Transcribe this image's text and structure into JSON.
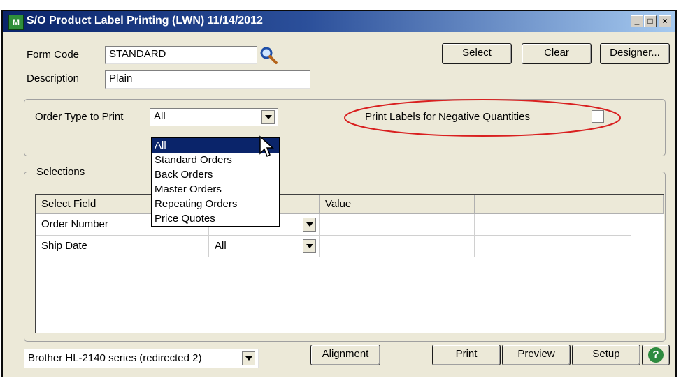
{
  "window": {
    "title": "S/O Product Label Printing (LWN) 11/14/2012",
    "app_icon_label": "M",
    "minimize_label": "_",
    "maximize_label": "□",
    "close_label": "×"
  },
  "form": {
    "form_code_label": "Form Code",
    "form_code_value": "STANDARD",
    "description_label": "Description",
    "description_value": "Plain"
  },
  "top_buttons": {
    "select": "Select",
    "clear": "Clear",
    "designer": "Designer..."
  },
  "order_type": {
    "label": "Order Type to Print",
    "selected": "All",
    "options": [
      "All",
      "Standard Orders",
      "Back Orders",
      "Master Orders",
      "Repeating Orders",
      "Price Quotes"
    ]
  },
  "negative_qty": {
    "label": "Print Labels for Negative Quantities",
    "checked": false,
    "highlight_color": "#d92020"
  },
  "selections": {
    "group_label": "Selections",
    "headers": [
      "Select Field",
      "",
      "Value",
      ""
    ],
    "rows": [
      {
        "field": "Order Number",
        "select": "All",
        "value": ""
      },
      {
        "field": "Ship Date",
        "select": "All",
        "value": ""
      }
    ]
  },
  "printer": {
    "selected": "Brother HL-2140 series (redirected 2)"
  },
  "bottom_buttons": {
    "alignment": "Alignment",
    "print": "Print",
    "preview": "Preview",
    "setup": "Setup",
    "help": "?"
  },
  "colors": {
    "titlebar_start": "#0a246a",
    "selection_highlight": "#0a246a",
    "help_green": "#2e8b3f"
  }
}
